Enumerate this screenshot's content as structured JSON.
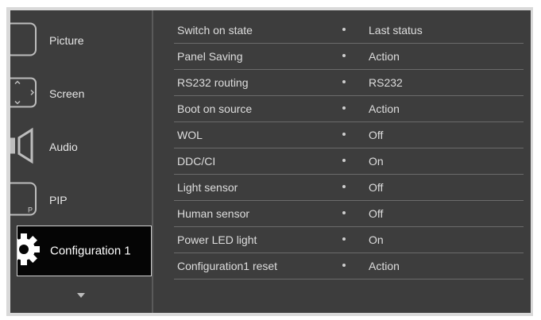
{
  "sidebar": {
    "items": [
      {
        "label": "Picture",
        "icon": "picture-icon"
      },
      {
        "label": "Screen",
        "icon": "screen-icon"
      },
      {
        "label": "Audio",
        "icon": "speaker-icon"
      },
      {
        "label": "PIP",
        "icon": "pip-icon"
      },
      {
        "label": "Configuration 1",
        "icon": "gear-icon",
        "selected": true
      }
    ],
    "scroll_icon": "chevron-down-icon"
  },
  "settings": [
    {
      "name": "Switch on state",
      "value": "Last status"
    },
    {
      "name": "Panel Saving",
      "value": "Action"
    },
    {
      "name": "RS232 routing",
      "value": "RS232"
    },
    {
      "name": "Boot on source",
      "value": "Action"
    },
    {
      "name": "WOL",
      "value": "Off"
    },
    {
      "name": "DDC/CI",
      "value": "On"
    },
    {
      "name": "Light sensor",
      "value": "Off"
    },
    {
      "name": "Human sensor",
      "value": "Off"
    },
    {
      "name": "Power LED light",
      "value": "On"
    },
    {
      "name": "Configuration1 reset",
      "value": "Action"
    }
  ],
  "pip_icon_letter": "P",
  "colors": {
    "osd_background": "#3d3d3d",
    "selected_background": "#050505",
    "text": "#dedede",
    "separator": "#6b6b6b"
  }
}
